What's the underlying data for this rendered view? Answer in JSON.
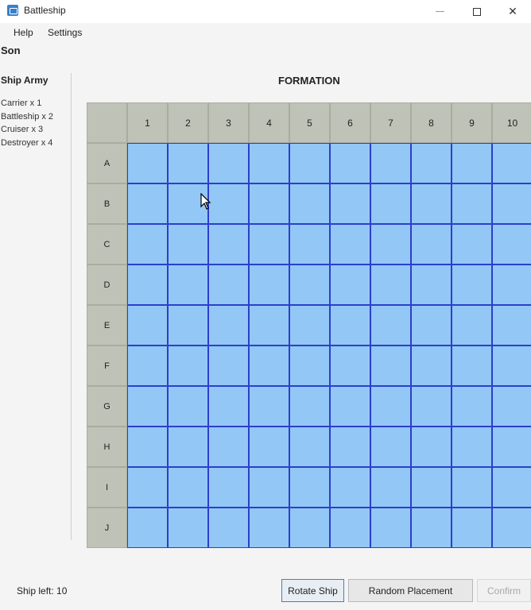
{
  "window": {
    "title": "Battleship",
    "minimize_label": "",
    "maximize_label": "",
    "close_label": "✕"
  },
  "menu": [
    "Help",
    "Settings"
  ],
  "player_name": "Son",
  "army": {
    "title": "Ship Army",
    "ships": [
      "Carrier x 1",
      "Battleship x 2",
      "Cruiser x 3",
      "Destroyer x 4"
    ]
  },
  "board": {
    "title": "FORMATION",
    "columns": [
      "1",
      "2",
      "3",
      "4",
      "5",
      "6",
      "7",
      "8",
      "9",
      "10"
    ],
    "rows": [
      "A",
      "B",
      "C",
      "D",
      "E",
      "F",
      "G",
      "H",
      "I",
      "J"
    ],
    "cell_color": "#93c7f6",
    "grid_line_color": "#2c3fc9",
    "header_color": "#bfc3b7"
  },
  "footer": {
    "ships_left": "Ship left: 10",
    "rotate_label": "Rotate Ship",
    "random_label": "Random Placement",
    "confirm_label": "Confirm"
  }
}
